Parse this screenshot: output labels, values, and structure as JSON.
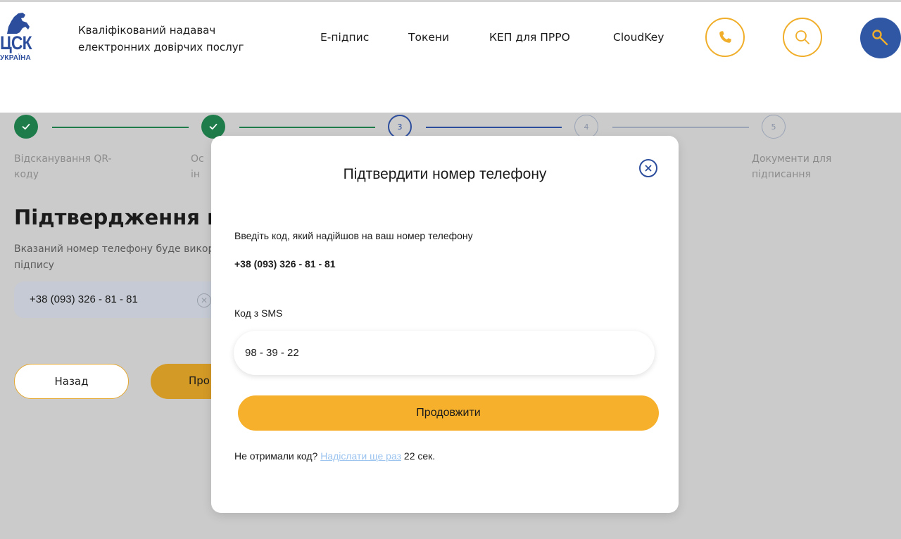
{
  "header": {
    "logo": {
      "text": "ЦСК",
      "sub": "УКРАЇНА"
    },
    "tagline": [
      "Кваліфікований надавач",
      "електронних довірчих послуг"
    ],
    "nav": [
      "Е-підпис",
      "Токени",
      "КЕП для ПРРО",
      "CloudKey"
    ],
    "icons": {
      "phone": "phone-icon",
      "search": "search-icon",
      "key": "key-icon"
    },
    "accent_color": "#f0ae2a",
    "brand_color": "#2f57a4"
  },
  "stepper": {
    "steps": [
      {
        "number": "1",
        "state": "done",
        "label_lines": [
          "Відсканування QR-",
          "коду"
        ]
      },
      {
        "number": "2",
        "state": "done",
        "label_lines": [
          "Ос",
          "ін"
        ]
      },
      {
        "number": "3",
        "state": "active",
        "label_lines": []
      },
      {
        "number": "4",
        "state": "pending",
        "label_lines": []
      },
      {
        "number": "5",
        "state": "pending",
        "label_lines": [
          "Документи для",
          "підписання"
        ]
      }
    ]
  },
  "background_form": {
    "title": "Підтвердження но",
    "description": [
      "Вказаний номер телефону буде викор",
      "підпису"
    ],
    "phone_value": "+38 (093) 326 - 81 - 81",
    "back_label": "Назад",
    "next_label": "Про"
  },
  "modal": {
    "title": "Підтвердити номер телефону",
    "instruction": "Введіть код, який надійшов на ваш номер телефону",
    "phone": "+38 (093) 326 - 81 - 81",
    "code_label": "Код з SMS",
    "code_value": "98 - 39 - 22",
    "submit_label": "Продовжити",
    "resend": {
      "prefix": "Не отримали код?",
      "link": "Надіслати ще раз",
      "timer": "22 сек."
    }
  }
}
